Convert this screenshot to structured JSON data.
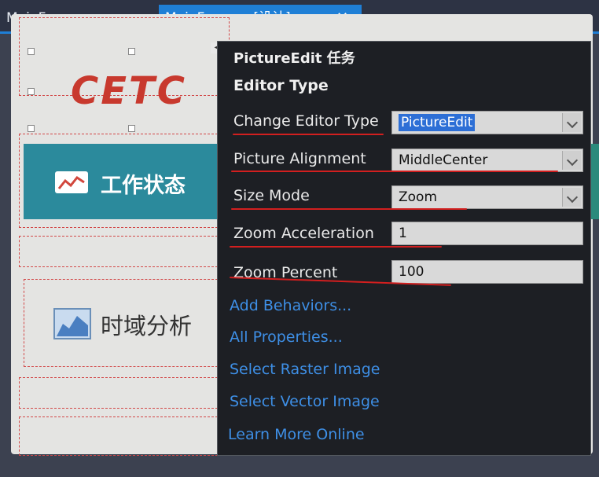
{
  "tabs": [
    {
      "label": "MainForm.cs"
    },
    {
      "label": "MainForm.cs [设计]",
      "pin_icon": "pin-icon",
      "close_icon": "close-icon"
    }
  ],
  "accent_color": "#1f7fd6",
  "designer": {
    "logo_text": "CETC",
    "logo_color": "#c8392e",
    "status_panel": {
      "label": "工作状态",
      "icon": "line-chart-icon",
      "color": "#2b8a9c"
    },
    "analysis_panel": {
      "label": "时域分析",
      "icon": "area-chart-icon"
    }
  },
  "smart_tag": {
    "title": "PictureEdit 任务",
    "section": "Editor Type",
    "properties": [
      {
        "label": "Change Editor Type",
        "value": "PictureEdit",
        "kind": "dropdown",
        "selected": true
      },
      {
        "label": "Picture Alignment",
        "value": "MiddleCenter",
        "kind": "dropdown"
      },
      {
        "label": "Size Mode",
        "value": "Zoom",
        "kind": "dropdown"
      },
      {
        "label": "Zoom Acceleration",
        "value": "1",
        "kind": "text"
      },
      {
        "label": "Zoom Percent",
        "value": "100",
        "kind": "text"
      }
    ],
    "links": [
      "Add Behaviors...",
      "All Properties...",
      "Select Raster Image",
      "Select Vector Image",
      "Learn More Online"
    ],
    "link_color": "#3e8fe6",
    "annotation_color": "#d21f1f"
  }
}
